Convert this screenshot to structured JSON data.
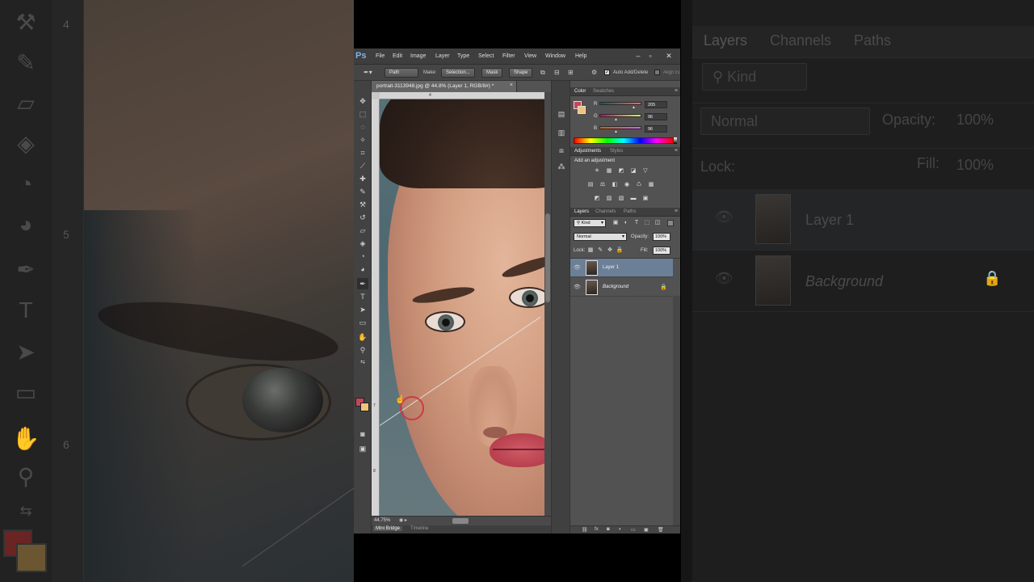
{
  "background_left": {
    "ruler_numbers": [
      "4",
      "5",
      "6"
    ]
  },
  "background_right": {
    "tabs": [
      "Layers",
      "Channels",
      "Paths"
    ],
    "kind_label": "Kind",
    "blend_mode": "Normal",
    "opacity_label": "Opacity:",
    "opacity_value": "100%",
    "lock_label": "Lock:",
    "fill_label": "Fill:",
    "fill_value": "100%",
    "layers": [
      "Layer 1",
      "Background"
    ]
  },
  "app": {
    "logo": "Ps",
    "menu": [
      "File",
      "Edit",
      "Image",
      "Layer",
      "Type",
      "Select",
      "Filter",
      "View",
      "Window",
      "Help"
    ],
    "window_controls": [
      "–",
      "▫",
      "✕"
    ]
  },
  "options_bar": {
    "mode": "Path",
    "make_label": "Make:",
    "selection_button": "Selection...",
    "mask_button": "Mask",
    "shape_button": "Shape",
    "auto_add_delete_label": "Auto Add/Delete",
    "align_edges_label": "Align Ed"
  },
  "document": {
    "tab_title": "portrait-3113948.jpg @ 44.8% (Layer 1, RGB/8#) *",
    "zoom": "44.75%",
    "ruler_top": [
      "4"
    ],
    "ruler_left": [
      "7",
      "8"
    ]
  },
  "bottom_tabs": [
    "Mini Bridge",
    "Timeline"
  ],
  "color_panel": {
    "tabs": [
      "Color",
      "Swatches"
    ],
    "channels": [
      {
        "label": "R",
        "value": "205"
      },
      {
        "label": "G",
        "value": "96"
      },
      {
        "label": "B",
        "value": "96"
      }
    ],
    "foreground": "#c4465a",
    "background": "#f1c27a"
  },
  "adjustments_panel": {
    "tabs": [
      "Adjustments",
      "Styles"
    ],
    "title": "Add an adjustment"
  },
  "layers_panel": {
    "tabs": [
      "Layers",
      "Channels",
      "Paths"
    ],
    "filter_kind": "Kind",
    "blend_mode": "Normal",
    "opacity_label": "Opacity:",
    "opacity_value": "100%",
    "lock_label": "Lock:",
    "fill_label": "Fill:",
    "fill_value": "100%",
    "layers": [
      {
        "name": "Layer 1",
        "selected": true,
        "locked": false
      },
      {
        "name": "Background",
        "selected": false,
        "locked": true
      }
    ]
  }
}
